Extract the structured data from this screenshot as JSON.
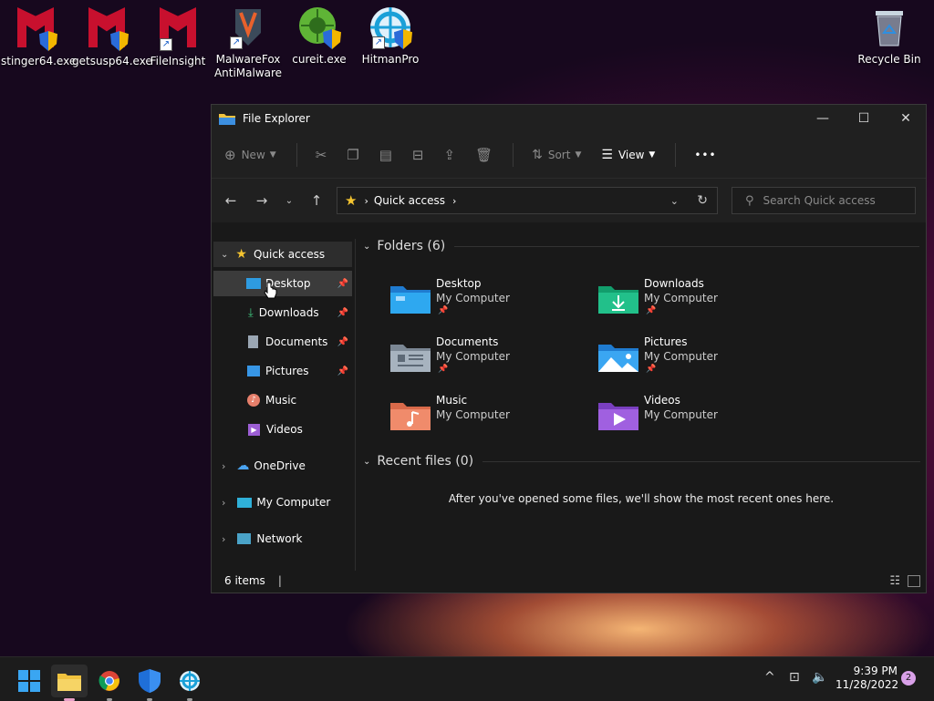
{
  "desktop": {
    "icons": [
      {
        "label": "stinger64.exe"
      },
      {
        "label": "getsusp64.exe"
      },
      {
        "label": "FileInsight"
      },
      {
        "label": "MalwareFox AntiMalware"
      },
      {
        "label": "cureit.exe"
      },
      {
        "label": "HitmanPro"
      },
      {
        "label": "Recycle Bin"
      }
    ]
  },
  "window": {
    "title": "File Explorer",
    "toolbar": {
      "new_label": "New",
      "sort_label": "Sort",
      "view_label": "View",
      "more_label": "•••"
    },
    "address": {
      "path": "Quick access"
    },
    "search": {
      "placeholder": "Search Quick access"
    },
    "sidebar": {
      "quick_access": "Quick access",
      "items": [
        {
          "label": "Desktop"
        },
        {
          "label": "Downloads"
        },
        {
          "label": "Documents"
        },
        {
          "label": "Pictures"
        },
        {
          "label": "Music"
        },
        {
          "label": "Videos"
        }
      ],
      "onedrive": "OneDrive",
      "my_computer": "My Computer",
      "network": "Network"
    },
    "folders_header": "Folders (6)",
    "folders": [
      {
        "name": "Desktop",
        "sub": "My Computer",
        "pinned": true
      },
      {
        "name": "Downloads",
        "sub": "My Computer",
        "pinned": true
      },
      {
        "name": "Documents",
        "sub": "My Computer",
        "pinned": true
      },
      {
        "name": "Pictures",
        "sub": "My Computer",
        "pinned": true
      },
      {
        "name": "Music",
        "sub": "My Computer",
        "pinned": false
      },
      {
        "name": "Videos",
        "sub": "My Computer",
        "pinned": false
      }
    ],
    "recent_header": "Recent files (0)",
    "recent_empty": "After you've opened some files, we'll show the most recent ones here.",
    "status_items": "6 items"
  },
  "taskbar": {
    "time": "9:39 PM",
    "date": "11/28/2022",
    "notification_count": "2"
  },
  "colors": {
    "accent": "#4aa3f0",
    "folder_blue": "#2e9be0"
  }
}
